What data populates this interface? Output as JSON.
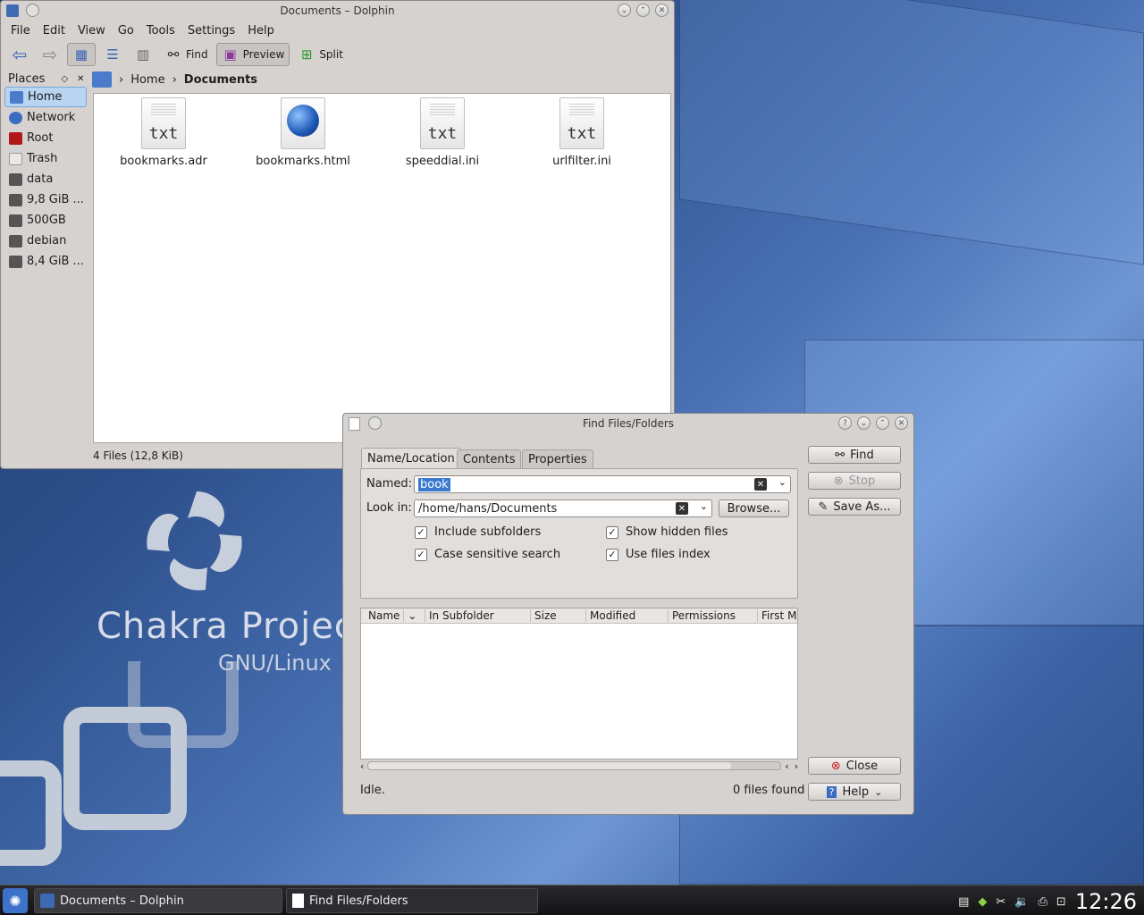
{
  "dolphin": {
    "title": "Documents – Dolphin",
    "menu": [
      "File",
      "Edit",
      "View",
      "Go",
      "Tools",
      "Settings",
      "Help"
    ],
    "toolbar": {
      "find": "Find",
      "preview": "Preview",
      "split": "Split"
    },
    "places_header": "Places",
    "places": [
      "Home",
      "Network",
      "Root",
      "Trash",
      "data",
      "9,8 GiB ...",
      "500GB",
      "debian",
      "8,4 GiB ..."
    ],
    "breadcrumb": {
      "home": "Home",
      "current": "Documents"
    },
    "files": [
      "bookmarks.adr",
      "bookmarks.html",
      "speeddial.ini",
      "urlfilter.ini"
    ],
    "file_icon_text": "txt",
    "status": "4 Files (12,8 KiB)"
  },
  "find": {
    "title": "Find Files/Folders",
    "tabs": [
      "Name/Location",
      "Contents",
      "Properties"
    ],
    "named_label": "Named:",
    "named_value": "book",
    "lookin_label": "Look in:",
    "lookin_value": "/home/hans/Documents",
    "browse": "Browse...",
    "checks": [
      "Include subfolders",
      "Case sensitive search",
      "Show hidden files",
      "Use files index"
    ],
    "columns": [
      "Name",
      "In Subfolder",
      "Size",
      "Modified",
      "Permissions",
      "First M"
    ],
    "buttons": {
      "find": "Find",
      "stop": "Stop",
      "saveas": "Save As...",
      "close": "Close",
      "help": "Help"
    },
    "status_left": "Idle.",
    "status_right": "0 files found"
  },
  "desktop": {
    "brand": "Chakra Projec",
    "brand2": "GNU/Linux"
  },
  "taskbar": {
    "task1": "Documents – Dolphin",
    "task2": "Find Files/Folders",
    "clock": "12:26"
  }
}
